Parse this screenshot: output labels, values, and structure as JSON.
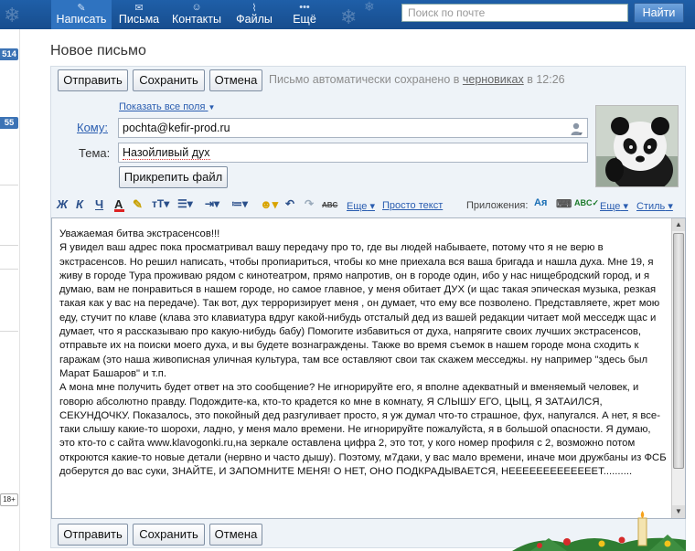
{
  "nav": {
    "items": [
      {
        "label": "Написать",
        "icon": "pencil-icon"
      },
      {
        "label": "Письма",
        "icon": "envelope-icon"
      },
      {
        "label": "Контакты",
        "icon": "contacts-icon"
      },
      {
        "label": "Файлы",
        "icon": "clip-icon"
      },
      {
        "label": "Ещё",
        "icon": "dots-icon"
      }
    ],
    "search_placeholder": "Поиск по почте",
    "find_label": "Найти"
  },
  "sidebar": {
    "badge1": "514",
    "badge2": "55",
    "age": "18+"
  },
  "page_title": "Новое письмо",
  "actions": {
    "send": "Отправить",
    "save": "Сохранить",
    "cancel": "Отмена"
  },
  "autosave": {
    "prefix": "Письмо автоматически сохранено в",
    "link": "черновиках",
    "suffix": "в 12:26"
  },
  "form": {
    "show_all_fields": "Показать все поля",
    "to_label": "Кому:",
    "to_value": "pochta@kefir-prod.ru",
    "subject_label": "Тема:",
    "subject_value": "Назойливый дух",
    "attach_label": "Прикрепить файл"
  },
  "toolbar": {
    "more": "Еще",
    "plain_text": "Просто текст",
    "apps_label": "Приложения:",
    "more2": "Еще",
    "style": "Стиль"
  },
  "message": {
    "body": "Уважаемая битва экстрасенсов!!!\nЯ увидел ваш адрес пока просматривал вашу передачу про то, где вы людей набываете, потому что я не верю в экстрасенсов. Но решил написать, чтобы пропиариться, чтобы ко мне приехала вся ваша бригада и нашла духа. Мне 19, я живу в городе Тура проживаю рядом с кинотеатром, прямо напротив, он в городе один, ибо у нас нищебродский город, и я думаю, вам не понравиться в нашем городе, но самое главное, у меня обитает ДУХ (и щас такая эпическая музыка, резкая такая как у вас на передаче). Так вот, дух терроризирует меня , он думает, что ему все позволено. Представляете, жрет мою еду, стучит по клаве (клава это клавиатура вдруг какой-нибудь отсталый дед из вашей редакции читает мой месседж щас и думает, что я рассказываю про какую-нибудь бабу) Помогите избавиться от духа, напрягите своих лучших экстрасенсов, отправьте их на поиски моего духа, и вы будете вознаграждены. Также во время съемок в нашем городе мона сходить к гаражам (это наша живописная уличная культура, там все оставляют свои так скажем месседжы. ну например \"здесь был Марат Башаров\" и т.п.\nА мона мне получить будет ответ на это сообщение? Не игнорируйте его, я вполне адекватный и вменяемый человек, и говорю абсолютно правду. Подождите-ка, кто-то крадется ко мне в комнату, Я СЛЫШУ ЕГО, ЦЫЦ, Я ЗАТАИЛСЯ, СЕКУНДОЧКУ. Показалось, это покойный дед разгуливает просто, я уж думал что-то страшное, фух, напугался. А нет, я все-таки слышу какие-то шорохи, ладно, у меня мало времени. Не игнорируйте пожалуйста, я в большой опасности. Я думаю, это кто-то с сайта www.klavogonki.ru,на зеркале оставлена цифра 2, это тот, у кого номер профиля с 2, возможно потом откроются какие-то новые детали (нервно и часто дышу). Поэтому, м7даки, у вас мало времени, иначе мои дружбаны из ФСБ доберутся до вас суки, ЗНАЙТЕ, И ЗАПОМНИТЕ МЕНЯ! О НЕТ, ОНО ПОДКРАДЫВАЕТСЯ, НЕЕЕЕЕЕЕЕЕЕЕЕЕТ.........."
  },
  "colors": {
    "nav_bg": "#1f5fa8",
    "link": "#2a5db0",
    "panel_bg": "#eef3f8"
  }
}
